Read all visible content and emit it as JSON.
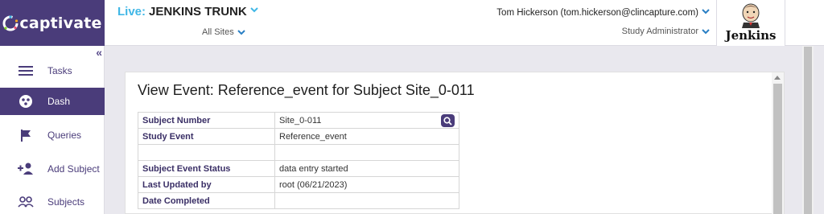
{
  "brand": {
    "logo_text": "captivate"
  },
  "header": {
    "live_label": "Live:",
    "study_name": "JENKINS TRUNK",
    "site_select": "All Sites",
    "user": "Tom Hickerson  (tom.hickerson@clincapture.com)",
    "role": "Study Administrator",
    "jenkins_label": "Jenkins"
  },
  "sidebar": {
    "collapse": "«",
    "items": [
      {
        "label": "Tasks",
        "icon": "menu-icon",
        "active": false
      },
      {
        "label": "Dash",
        "icon": "dashboard-icon",
        "active": true
      },
      {
        "label": "Queries",
        "icon": "flag-icon",
        "active": false
      },
      {
        "label": "Add Subject",
        "icon": "add-person-icon",
        "active": false
      },
      {
        "label": "Subjects",
        "icon": "people-icon",
        "active": false
      }
    ]
  },
  "main": {
    "title": "View Event: Reference_event for Subject Site_0-011",
    "rows": [
      {
        "label": "Subject Number",
        "value": "Site_0-011"
      },
      {
        "label": "Study Event",
        "value": "Reference_event"
      },
      {
        "label": "",
        "value": ""
      },
      {
        "label": "Subject Event Status",
        "value": "data entry started"
      },
      {
        "label": "Last Updated by",
        "value": "root (06/21/2023)"
      },
      {
        "label": "Date Completed",
        "value": ""
      }
    ]
  },
  "colors": {
    "brand": "#4a3c7a",
    "accent": "#40b7e6"
  }
}
